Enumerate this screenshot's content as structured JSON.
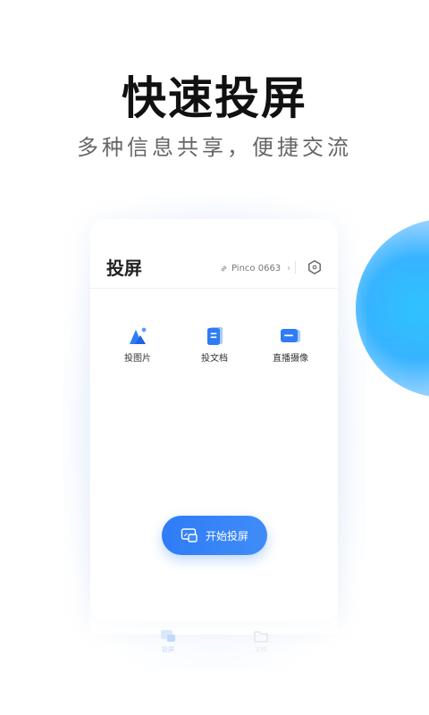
{
  "headline": "快速投屏",
  "subheadline": "多种信息共享，便捷交流",
  "card": {
    "title": "投屏",
    "device_name": "Pinco 0663",
    "device_chevron": "›",
    "settings_icon": "hexagon-settings-icon",
    "features": [
      {
        "label": "投图片",
        "icon": "photo-icon"
      },
      {
        "label": "投文档",
        "icon": "document-icon"
      },
      {
        "label": "直播摄像",
        "icon": "camera-live-icon"
      }
    ],
    "start_button": "开始投屏"
  },
  "tabbar": {
    "tabs": [
      {
        "label": "投屏",
        "icon": "cast-tab-icon"
      },
      {
        "label": "文件",
        "icon": "folder-tab-icon"
      }
    ]
  },
  "colors": {
    "primary": "#2f7cf6",
    "accent_glow": "#2fc2ff",
    "headline": "#111111",
    "subheadline": "#666666"
  }
}
